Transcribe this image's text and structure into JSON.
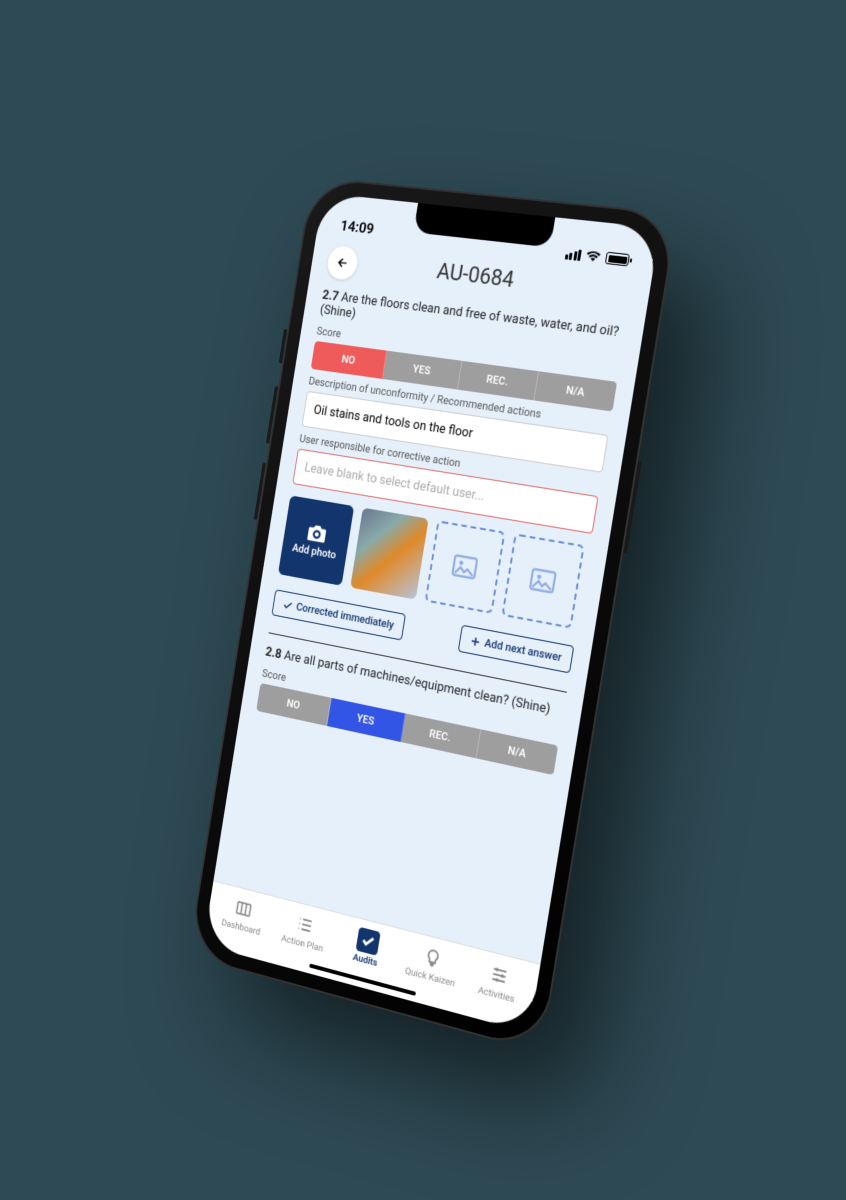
{
  "status": {
    "time": "14:09"
  },
  "header": {
    "title": "AU-0684"
  },
  "q1": {
    "number": "2.7",
    "text": "Are the floors clean and free of waste, water, and oil? (Shine)",
    "score_label": "Score",
    "options": {
      "no": "NO",
      "yes": "YES",
      "rec": "REC.",
      "na": "N/A"
    },
    "selected": "NO",
    "desc_label": "Description of unconformity / Recommended actions",
    "desc_value": "Oil stains and tools on the floor",
    "user_label": "User responsible for corrective action",
    "user_placeholder": "Leave blank to select default user...",
    "add_photo": "Add photo",
    "corrected_btn": "Corrected immediately",
    "add_next_btn": "Add next answer"
  },
  "q2": {
    "number": "2.8",
    "text": "Are all parts of machines/equipment clean? (Shine)",
    "score_label": "Score",
    "options": {
      "no": "NO",
      "yes": "YES",
      "rec": "REC.",
      "na": "N/A"
    },
    "selected": "YES"
  },
  "tabs": {
    "dashboard": "Dashboard",
    "action_plan": "Action Plan",
    "audits": "Audits",
    "quick_kaizen": "Quick Kaizen",
    "activities": "Activities"
  }
}
